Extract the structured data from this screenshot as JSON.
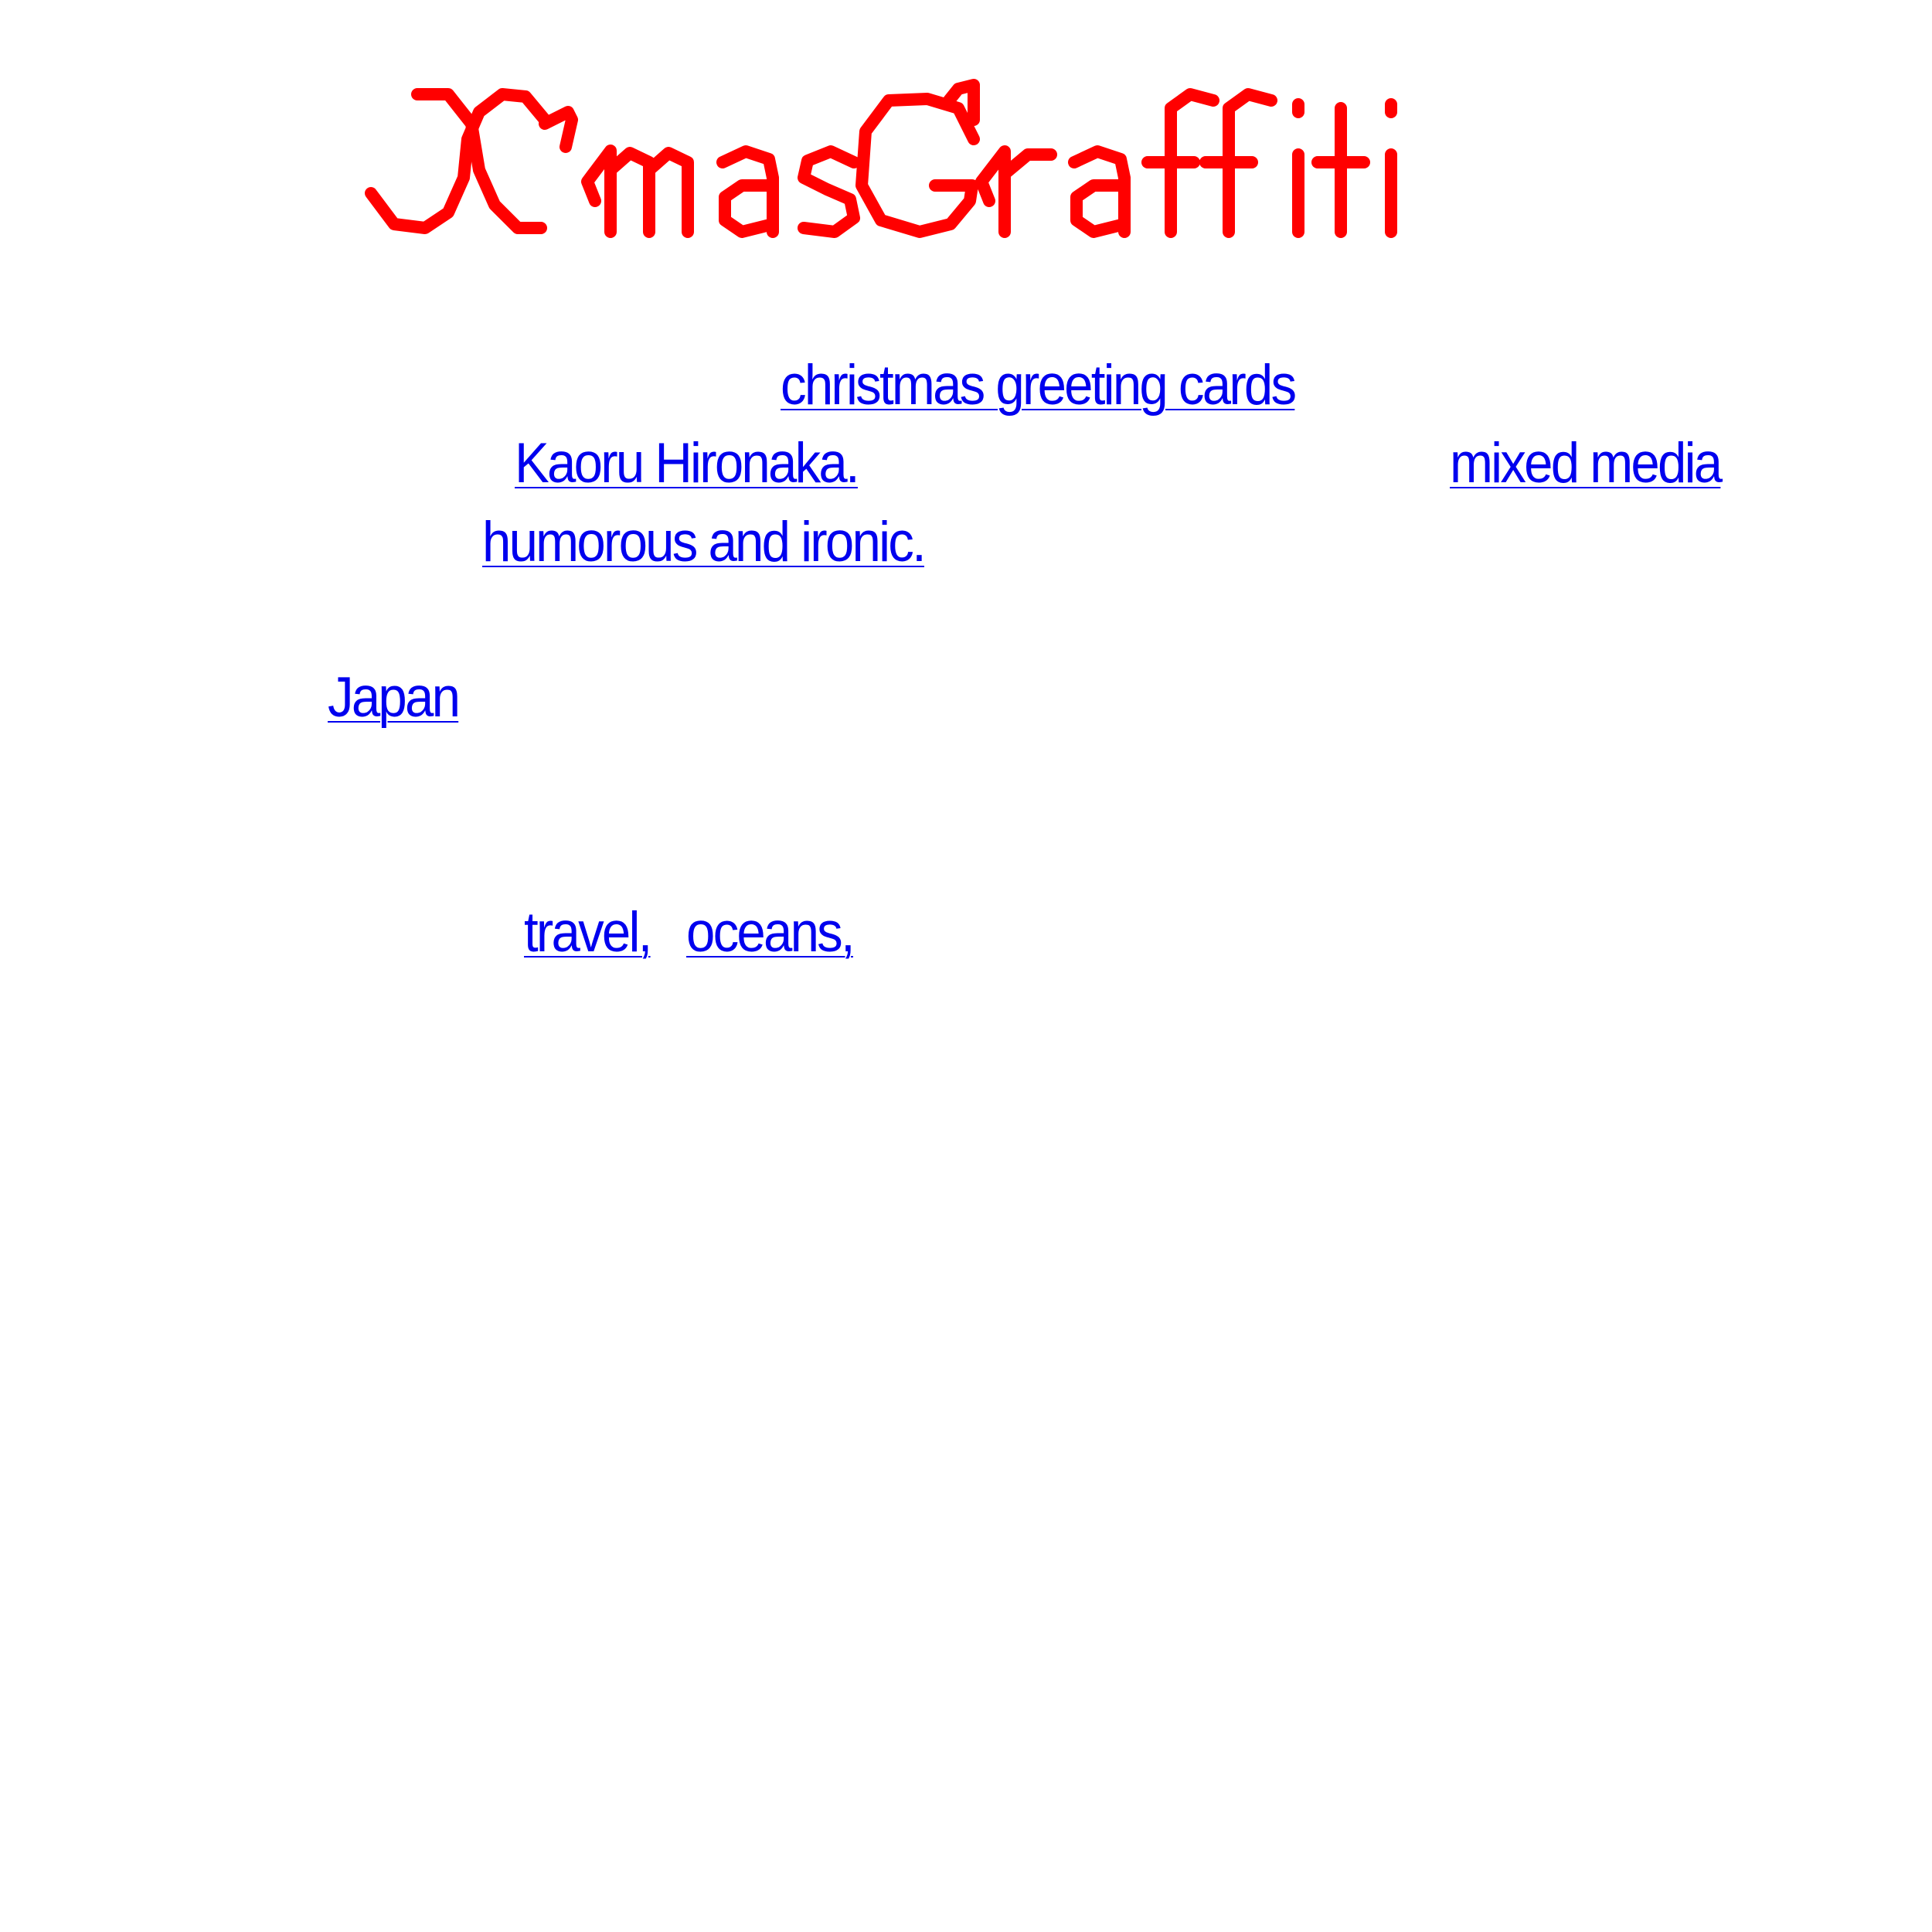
{
  "title": {
    "text": "X'mas Graffiti",
    "color": "#ff0000"
  },
  "links": {
    "christmas_cards": "christmas greeting cards",
    "artist": "Kaoru Hironaka.",
    "mixed_media": "mixed media",
    "humorous": "humorous and ironic.",
    "japan": "Japan",
    "travel": "travel,",
    "oceans": "oceans,"
  },
  "link_color": "#0000ee"
}
